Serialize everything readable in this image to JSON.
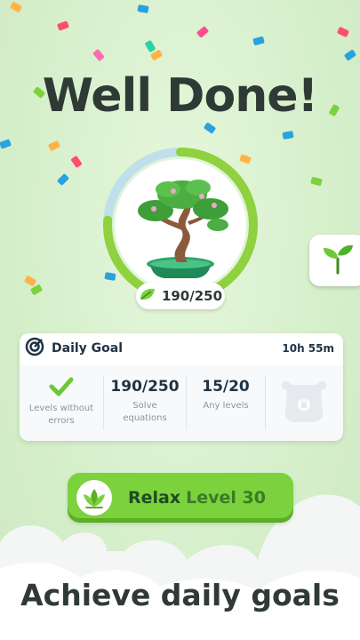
{
  "screen": {
    "headline": "Well Done!",
    "footer": "Achieve daily goals"
  },
  "tree": {
    "progress_label": "190/250",
    "progress_fraction": 0.76
  },
  "daily_goal": {
    "title": "Daily Goal",
    "timer": "10h 55m",
    "goals": [
      {
        "value": "",
        "label": "Levels without errors",
        "status": "complete"
      },
      {
        "value": "190/250",
        "label": "Solve equations",
        "status": "in-progress"
      },
      {
        "value": "15/20",
        "label": "Any levels",
        "status": "in-progress"
      },
      {
        "value": "",
        "label": "",
        "status": "locked"
      }
    ]
  },
  "relax_button": {
    "label": "Relax",
    "level": "Level 30"
  },
  "colors": {
    "accent_green": "#7bd23d",
    "ring_green": "#8fd13f",
    "ring_track": "#bfe0ea",
    "text_dark": "#2f3a36"
  },
  "icons": [
    "target-icon",
    "checkmark-icon",
    "lock-icon",
    "leaf-icon",
    "sprout-icon",
    "lotus-icon",
    "bonsai-tree-icon"
  ]
}
